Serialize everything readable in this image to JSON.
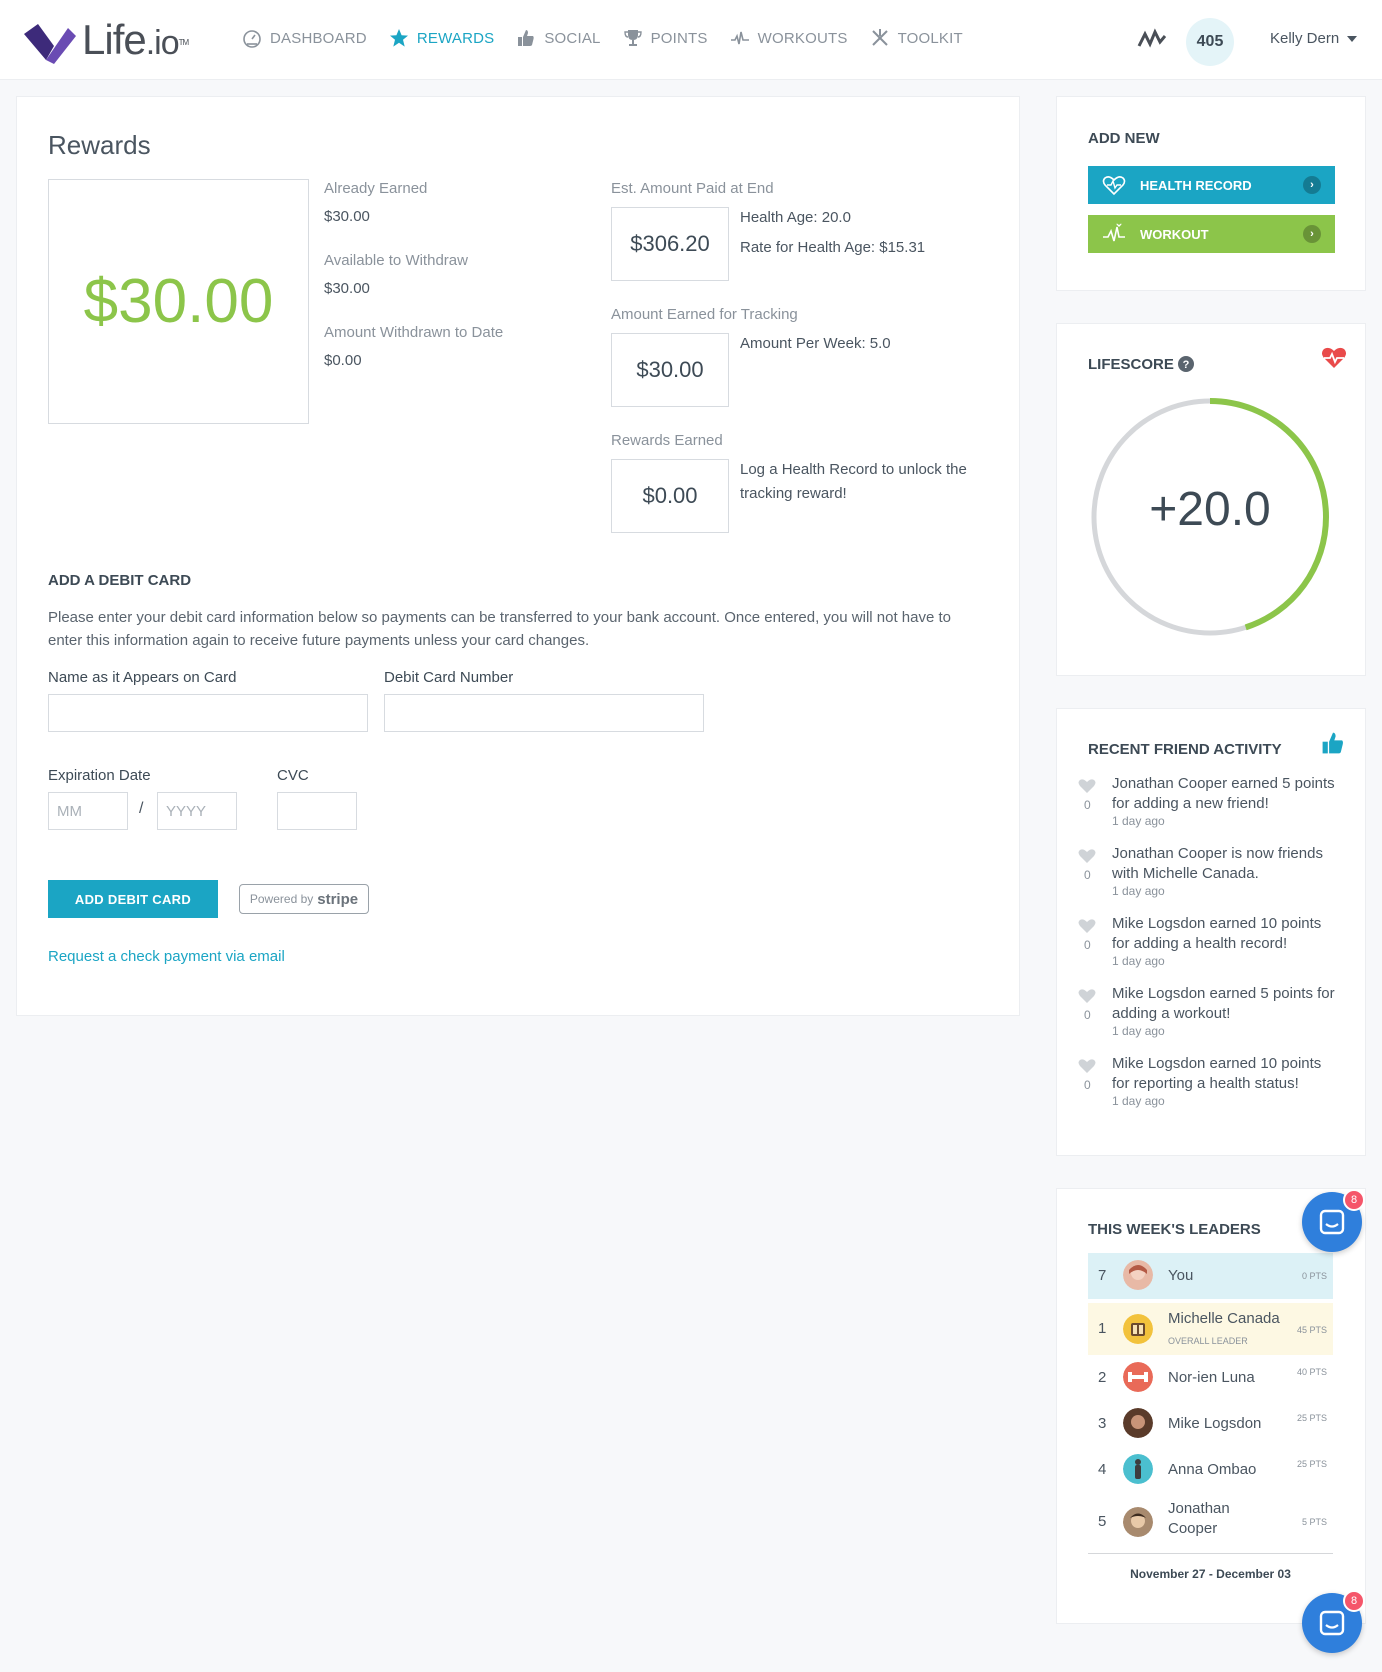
{
  "brand": {
    "name": "Life",
    "suffix": "io",
    "tm": "TM"
  },
  "nav": [
    {
      "label": "DASHBOARD",
      "icon": "dashboard-icon"
    },
    {
      "label": "REWARDS",
      "icon": "star-icon",
      "active": true
    },
    {
      "label": "SOCIAL",
      "icon": "thumbs-up-icon"
    },
    {
      "label": "POINTS",
      "icon": "trophy-icon"
    },
    {
      "label": "WORKOUTS",
      "icon": "pulse-icon"
    },
    {
      "label": "TOOLKIT",
      "icon": "tools-icon"
    }
  ],
  "header": {
    "points": "405",
    "user": "Kelly Dern"
  },
  "rewards": {
    "title": "Rewards",
    "big_amount": "$30.00",
    "already_earned_label": "Already Earned",
    "already_earned": "$30.00",
    "available_label": "Available to Withdraw",
    "available": "$30.00",
    "withdrawn_label": "Amount Withdrawn to Date",
    "withdrawn": "$0.00",
    "est_label": "Est. Amount Paid at End",
    "est_value": "$306.20",
    "health_age": "Health Age: 20.0",
    "rate": "Rate for Health Age: $15.31",
    "tracking_label": "Amount Earned for Tracking",
    "tracking_value": "$30.00",
    "per_week": "Amount Per Week: 5.0",
    "earned_label": "Rewards Earned",
    "earned_value": "$0.00",
    "earned_note": "Log a Health Record to unlock the tracking reward!"
  },
  "debit": {
    "heading": "ADD A DEBIT CARD",
    "paragraph": "Please enter your debit card information below so payments can be transferred to your bank account. Once entered, you will not have to enter this information again to receive future payments unless your card changes.",
    "name_label": "Name as it Appears on Card",
    "number_label": "Debit Card Number",
    "exp_label": "Expiration Date",
    "cvc_label": "CVC",
    "mm_placeholder": "MM",
    "yyyy_placeholder": "YYYY",
    "slash": "/",
    "button": "ADD DEBIT CARD",
    "stripe_prefix": "Powered by",
    "stripe_brand": "stripe",
    "check_link": "Request a check payment via email"
  },
  "add_new": {
    "heading": "ADD NEW",
    "health_record": "HEALTH RECORD",
    "workout": "WORKOUT",
    "health_color": "#1ba5c4",
    "workout_color": "#8cc54a"
  },
  "lifescore": {
    "heading": "LIFESCORE",
    "value": "+20.0",
    "progress": 0.45
  },
  "activity": {
    "heading": "RECENT FRIEND ACTIVITY",
    "items": [
      {
        "count": "0",
        "text": "Jonathan Cooper earned 5 points for adding a new friend!",
        "time": "1 day ago"
      },
      {
        "count": "0",
        "text": "Jonathan Cooper is now friends with Michelle Canada.",
        "time": "1 day ago"
      },
      {
        "count": "0",
        "text": "Mike Logsdon earned 10 points for adding a health record!",
        "time": "1 day ago"
      },
      {
        "count": "0",
        "text": "Mike Logsdon earned 5 points for adding a workout!",
        "time": "1 day ago"
      },
      {
        "count": "0",
        "text": "Mike Logsdon earned 10 points for reporting a health status!",
        "time": "1 day ago"
      }
    ]
  },
  "leaders": {
    "heading": "THIS WEEK'S LEADERS",
    "rows": [
      {
        "rank": "7",
        "name": "You",
        "pts": "0 PTS",
        "sub": ""
      },
      {
        "rank": "1",
        "name": "Michelle Canada",
        "pts": "45 PTS",
        "sub": "OVERALL LEADER"
      },
      {
        "rank": "2",
        "name": "Nor-ien Luna",
        "pts": "40 PTS",
        "sub": ""
      },
      {
        "rank": "3",
        "name": "Mike Logsdon",
        "pts": "25 PTS",
        "sub": ""
      },
      {
        "rank": "4",
        "name": "Anna Ombao",
        "pts": "25 PTS",
        "sub": ""
      },
      {
        "rank": "5",
        "name": "Jonathan Cooper",
        "pts": "5 PTS",
        "sub": ""
      }
    ],
    "range": "November 27 - December 03"
  },
  "chat": {
    "badge": "8"
  }
}
